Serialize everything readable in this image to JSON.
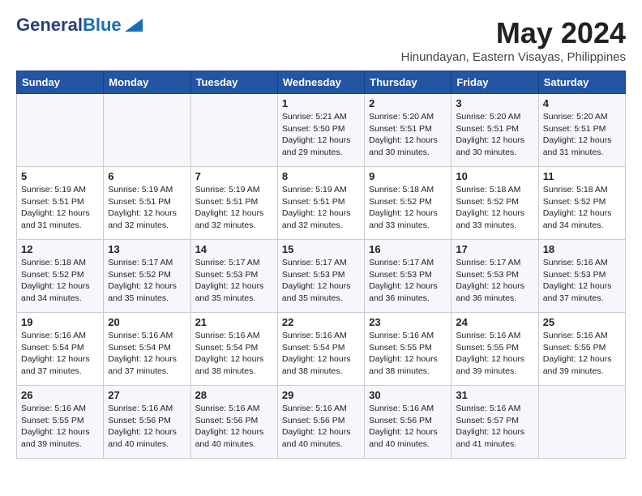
{
  "header": {
    "logo_line1": "General",
    "logo_line2": "Blue",
    "month": "May 2024",
    "location": "Hinundayan, Eastern Visayas, Philippines"
  },
  "days_of_week": [
    "Sunday",
    "Monday",
    "Tuesday",
    "Wednesday",
    "Thursday",
    "Friday",
    "Saturday"
  ],
  "weeks": [
    [
      {
        "day": "",
        "info": ""
      },
      {
        "day": "",
        "info": ""
      },
      {
        "day": "",
        "info": ""
      },
      {
        "day": "1",
        "info": "Sunrise: 5:21 AM\nSunset: 5:50 PM\nDaylight: 12 hours\nand 29 minutes."
      },
      {
        "day": "2",
        "info": "Sunrise: 5:20 AM\nSunset: 5:51 PM\nDaylight: 12 hours\nand 30 minutes."
      },
      {
        "day": "3",
        "info": "Sunrise: 5:20 AM\nSunset: 5:51 PM\nDaylight: 12 hours\nand 30 minutes."
      },
      {
        "day": "4",
        "info": "Sunrise: 5:20 AM\nSunset: 5:51 PM\nDaylight: 12 hours\nand 31 minutes."
      }
    ],
    [
      {
        "day": "5",
        "info": "Sunrise: 5:19 AM\nSunset: 5:51 PM\nDaylight: 12 hours\nand 31 minutes."
      },
      {
        "day": "6",
        "info": "Sunrise: 5:19 AM\nSunset: 5:51 PM\nDaylight: 12 hours\nand 32 minutes."
      },
      {
        "day": "7",
        "info": "Sunrise: 5:19 AM\nSunset: 5:51 PM\nDaylight: 12 hours\nand 32 minutes."
      },
      {
        "day": "8",
        "info": "Sunrise: 5:19 AM\nSunset: 5:51 PM\nDaylight: 12 hours\nand 32 minutes."
      },
      {
        "day": "9",
        "info": "Sunrise: 5:18 AM\nSunset: 5:52 PM\nDaylight: 12 hours\nand 33 minutes."
      },
      {
        "day": "10",
        "info": "Sunrise: 5:18 AM\nSunset: 5:52 PM\nDaylight: 12 hours\nand 33 minutes."
      },
      {
        "day": "11",
        "info": "Sunrise: 5:18 AM\nSunset: 5:52 PM\nDaylight: 12 hours\nand 34 minutes."
      }
    ],
    [
      {
        "day": "12",
        "info": "Sunrise: 5:18 AM\nSunset: 5:52 PM\nDaylight: 12 hours\nand 34 minutes."
      },
      {
        "day": "13",
        "info": "Sunrise: 5:17 AM\nSunset: 5:52 PM\nDaylight: 12 hours\nand 35 minutes."
      },
      {
        "day": "14",
        "info": "Sunrise: 5:17 AM\nSunset: 5:53 PM\nDaylight: 12 hours\nand 35 minutes."
      },
      {
        "day": "15",
        "info": "Sunrise: 5:17 AM\nSunset: 5:53 PM\nDaylight: 12 hours\nand 35 minutes."
      },
      {
        "day": "16",
        "info": "Sunrise: 5:17 AM\nSunset: 5:53 PM\nDaylight: 12 hours\nand 36 minutes."
      },
      {
        "day": "17",
        "info": "Sunrise: 5:17 AM\nSunset: 5:53 PM\nDaylight: 12 hours\nand 36 minutes."
      },
      {
        "day": "18",
        "info": "Sunrise: 5:16 AM\nSunset: 5:53 PM\nDaylight: 12 hours\nand 37 minutes."
      }
    ],
    [
      {
        "day": "19",
        "info": "Sunrise: 5:16 AM\nSunset: 5:54 PM\nDaylight: 12 hours\nand 37 minutes."
      },
      {
        "day": "20",
        "info": "Sunrise: 5:16 AM\nSunset: 5:54 PM\nDaylight: 12 hours\nand 37 minutes."
      },
      {
        "day": "21",
        "info": "Sunrise: 5:16 AM\nSunset: 5:54 PM\nDaylight: 12 hours\nand 38 minutes."
      },
      {
        "day": "22",
        "info": "Sunrise: 5:16 AM\nSunset: 5:54 PM\nDaylight: 12 hours\nand 38 minutes."
      },
      {
        "day": "23",
        "info": "Sunrise: 5:16 AM\nSunset: 5:55 PM\nDaylight: 12 hours\nand 38 minutes."
      },
      {
        "day": "24",
        "info": "Sunrise: 5:16 AM\nSunset: 5:55 PM\nDaylight: 12 hours\nand 39 minutes."
      },
      {
        "day": "25",
        "info": "Sunrise: 5:16 AM\nSunset: 5:55 PM\nDaylight: 12 hours\nand 39 minutes."
      }
    ],
    [
      {
        "day": "26",
        "info": "Sunrise: 5:16 AM\nSunset: 5:55 PM\nDaylight: 12 hours\nand 39 minutes."
      },
      {
        "day": "27",
        "info": "Sunrise: 5:16 AM\nSunset: 5:56 PM\nDaylight: 12 hours\nand 40 minutes."
      },
      {
        "day": "28",
        "info": "Sunrise: 5:16 AM\nSunset: 5:56 PM\nDaylight: 12 hours\nand 40 minutes."
      },
      {
        "day": "29",
        "info": "Sunrise: 5:16 AM\nSunset: 5:56 PM\nDaylight: 12 hours\nand 40 minutes."
      },
      {
        "day": "30",
        "info": "Sunrise: 5:16 AM\nSunset: 5:56 PM\nDaylight: 12 hours\nand 40 minutes."
      },
      {
        "day": "31",
        "info": "Sunrise: 5:16 AM\nSunset: 5:57 PM\nDaylight: 12 hours\nand 41 minutes."
      },
      {
        "day": "",
        "info": ""
      }
    ]
  ]
}
